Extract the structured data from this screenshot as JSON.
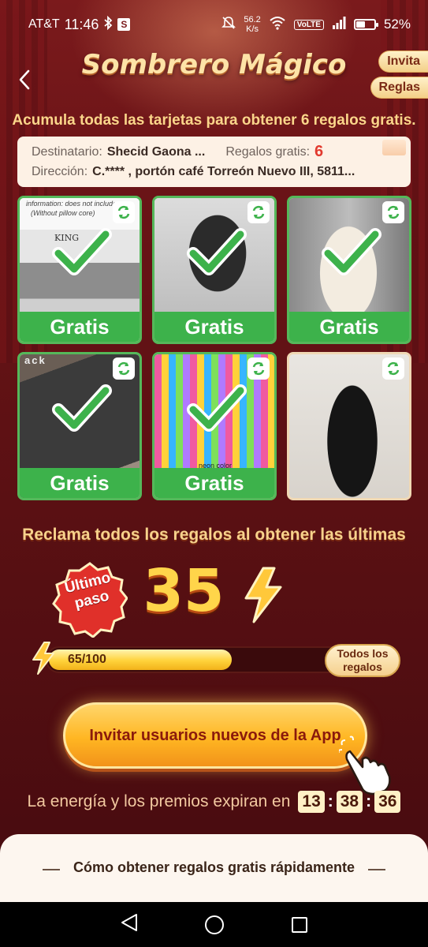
{
  "status_bar": {
    "carrier": "AT&T",
    "time": "11:46",
    "network_speed": "56.2",
    "network_speed_unit": "K/s",
    "volte": "VoLTE",
    "battery": "52%",
    "battery_level": 0.52
  },
  "header": {
    "title": "Sombrero Mágico",
    "invite_label": "Invita",
    "rules_label": "Reglas"
  },
  "subtitle": "Acumula todas las tarjetas para obtener 6 regalos gratis.",
  "address": {
    "recipient_label": "Destinatario:",
    "recipient_value": "Shecid Gaona ...",
    "gifts_label": "Regalos gratis:",
    "gifts_value": "6",
    "address_label": "Dirección:",
    "address_value": "C.**** , portón café Torreón Nuevo III, 5811..."
  },
  "gifts": [
    {
      "label": "Gratis",
      "claimed": true,
      "product": "quilted mattress cover",
      "caption": "information: does not include",
      "caption2": "(Without pillow core)",
      "brand": "KING"
    },
    {
      "label": "Gratis",
      "claimed": true,
      "product": "black hoodie set"
    },
    {
      "label": "Gratis",
      "claimed": true,
      "product": "cream knit dress"
    },
    {
      "label": "Gratis",
      "claimed": true,
      "product": "black notebook",
      "caption": "ack"
    },
    {
      "label": "Gratis",
      "claimed": true,
      "product": "gel pens set",
      "caption": "neon color"
    },
    {
      "label": "",
      "claimed": false,
      "product": "black flare pants"
    }
  ],
  "claim_text": "Reclama todos los regalos al obtener las últimas",
  "badge": {
    "line1": "Último",
    "line2": "paso"
  },
  "remaining": "35",
  "progress": {
    "text": "65/100",
    "value": 65,
    "max": 100,
    "all_gifts_label_1": "Todos los",
    "all_gifts_label_2": "regalos"
  },
  "cta_label": "Invitar usuarios nuevos de la App",
  "timer": {
    "label": "La energía y los premios expiran en",
    "hours": "13",
    "minutes": "38",
    "seconds": "36"
  },
  "sheet_title": "Cómo obtener regalos gratis rápidamente",
  "colors": {
    "background": "#5a1114",
    "gratis_green": "#3db24b",
    "accent_gold": "#ffd54a",
    "cta_orange": "#ffb622"
  }
}
